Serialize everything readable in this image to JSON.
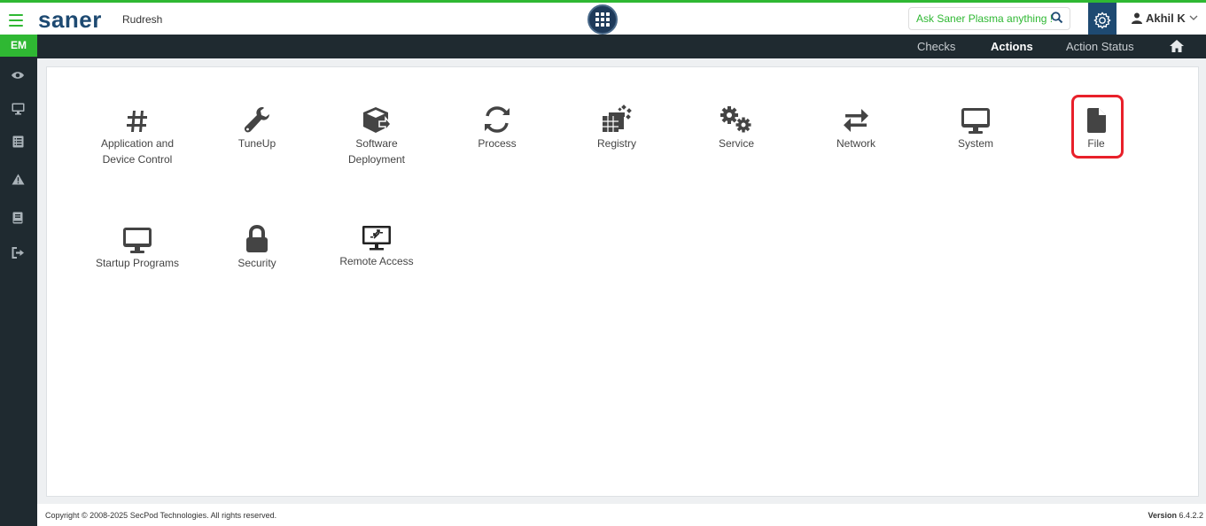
{
  "header": {
    "logo": "saner",
    "org": "Rudresh",
    "ask_placeholder": "Ask Saner Plasma anything !",
    "user": "Akhil K"
  },
  "nav": {
    "items": [
      "Checks",
      "Actions",
      "Action Status"
    ],
    "active": "Actions"
  },
  "sidebar": {
    "badge": "EM",
    "icons": [
      "eye-icon",
      "monitor-icon",
      "list-icon",
      "warning-icon",
      "book-icon",
      "logout-icon"
    ]
  },
  "tiles": [
    {
      "line1": "Application and",
      "line2": "Device Control",
      "icon": "hash-icon"
    },
    {
      "line1": "TuneUp",
      "line2": "",
      "icon": "wrench-icon"
    },
    {
      "line1": "Software",
      "line2": "Deployment",
      "icon": "box-icon"
    },
    {
      "line1": "Process",
      "line2": "",
      "icon": "refresh-icon"
    },
    {
      "line1": "Registry",
      "line2": "",
      "icon": "cubes-icon"
    },
    {
      "line1": "Service",
      "line2": "",
      "icon": "gears-icon"
    },
    {
      "line1": "Network",
      "line2": "",
      "icon": "exchange-icon"
    },
    {
      "line1": "System",
      "line2": "",
      "icon": "desktop-icon"
    },
    {
      "line1": "File",
      "line2": "",
      "icon": "file-icon"
    },
    {
      "line1": "Startup Programs",
      "line2": "",
      "icon": "desktop-icon"
    },
    {
      "line1": "Security",
      "line2": "",
      "icon": "lock-icon"
    },
    {
      "line1": "Remote Access",
      "line2": "",
      "icon": "remote-desktop-icon"
    }
  ],
  "footer": {
    "copyright": "Copyright © 2008-2025 SecPod Technologies. All rights reserved.",
    "version_label": "Version",
    "version": "6.4.2.2"
  },
  "colors": {
    "accent_green": "#2fb833",
    "brand_blue": "#1e4a72",
    "dark_bar": "#1f2a30",
    "highlight_red": "#e8202a"
  }
}
